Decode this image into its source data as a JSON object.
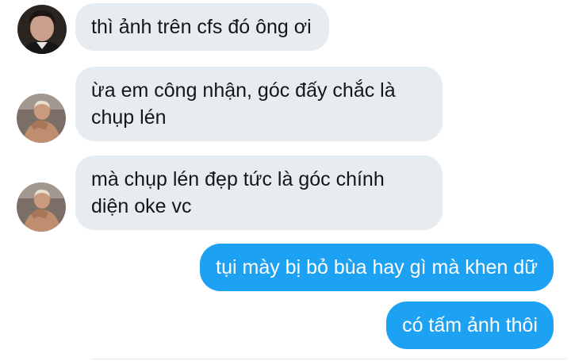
{
  "messages": [
    {
      "direction": "incoming",
      "avatar": "user-a-avatar",
      "lines": [
        "thì ảnh trên cfs đó ông ơi"
      ]
    },
    {
      "direction": "incoming",
      "avatar": "user-b-avatar",
      "lines": [
        "ừa em công nhận, góc đấy chắc là",
        "chụp lén"
      ]
    },
    {
      "direction": "incoming",
      "avatar": "user-b-avatar",
      "lines": [
        "mà chụp lén đẹp tức là góc chính",
        "diện oke vc"
      ]
    },
    {
      "direction": "outgoing",
      "lines": [
        "tụi mày bị bỏ bùa hay gì mà khen dữ"
      ]
    },
    {
      "direction": "outgoing",
      "lines": [
        "có tấm ảnh thôi"
      ]
    }
  ],
  "colors": {
    "incoming_bg": "#e6ecf0",
    "incoming_text": "#14171a",
    "outgoing_bg": "#1da1f2",
    "outgoing_text": "#ffffff"
  }
}
